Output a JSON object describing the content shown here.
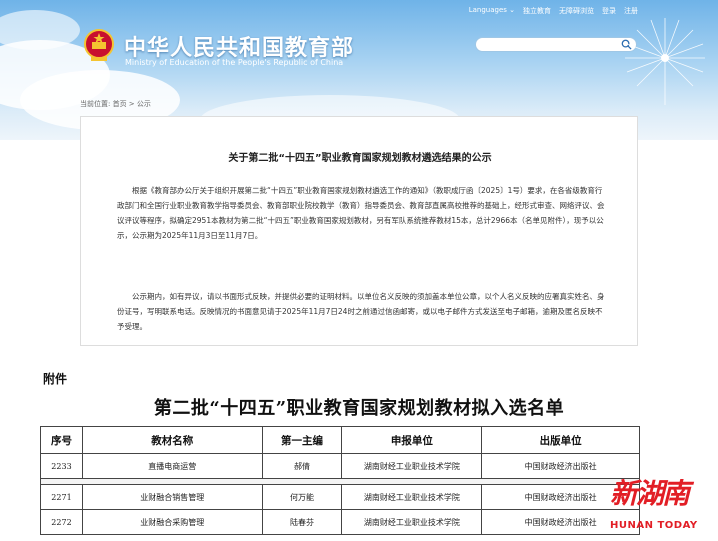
{
  "header": {
    "topbar": [
      "Languages ⌄",
      "独立教育",
      "无障碍浏览",
      "登录",
      "注册"
    ],
    "title_cn": "中华人民共和国教育部",
    "title_en": "Ministry of Education of the People's Republic of China",
    "search_placeholder": "",
    "search_icon": "search-icon"
  },
  "breadcrumb": "当前位置: 首页 > 公示",
  "notice": {
    "title": "关于第二批“十四五”职业教育国家规划教材遴选结果的公示",
    "para1": "根据《教育部办公厅关于组织开展第二批“十四五”职业教育国家规划教材遴选工作的通知》（教职成厅函〔2025〕1号）要求，在各省级教育行政部门和全国行业职业教育教学指导委员会、教育部职业院校教学（教育）指导委员会、教育部直属高校推荐的基础上，经形式审查、网络评议、会议评议等程序，拟确定2951本教材为第二批“十四五”职业教育国家规划教材，另有军队系统推荐教材15本，总计2966本（名单见附件），现予以公示，公示期为2025年11月3日至11月7日。",
    "para2": "公示期内，如有异议，请以书面形式反映，并提供必要的证明材料。以单位名义反映的须加盖本单位公章，以个人名义反映的应署真实姓名、身份证号，写明联系电话。反映情况的书面意见请于2025年11月7日24时之前通过信函邮寄，或以电子邮件方式发送至电子邮箱，逾期及匿名反映不予受理。"
  },
  "attachment": {
    "label": "附件",
    "list_title": "第二批“十四五”职业教育国家规划教材拟入选名单",
    "headers": [
      "序号",
      "教材名称",
      "第一主编",
      "申报单位",
      "出版单位"
    ],
    "rows": [
      [
        "2233",
        "直播电商运营",
        "郝倩",
        "湖南财经工业职业技术学院",
        "中国财政经济出版社"
      ],
      [
        "2271",
        "业财融合销售管理",
        "何万能",
        "湖南财经工业职业技术学院",
        "中国财政经济出版社"
      ],
      [
        "2272",
        "业财融合采购管理",
        "陆春芬",
        "湖南财经工业职业技术学院",
        "中国财政经济出版社"
      ]
    ]
  },
  "watermark": {
    "cn": "新湖南",
    "en": "HUNAN TODAY"
  },
  "colors": {
    "sky": "#6fb3e8",
    "watermark": "#e21e25"
  }
}
